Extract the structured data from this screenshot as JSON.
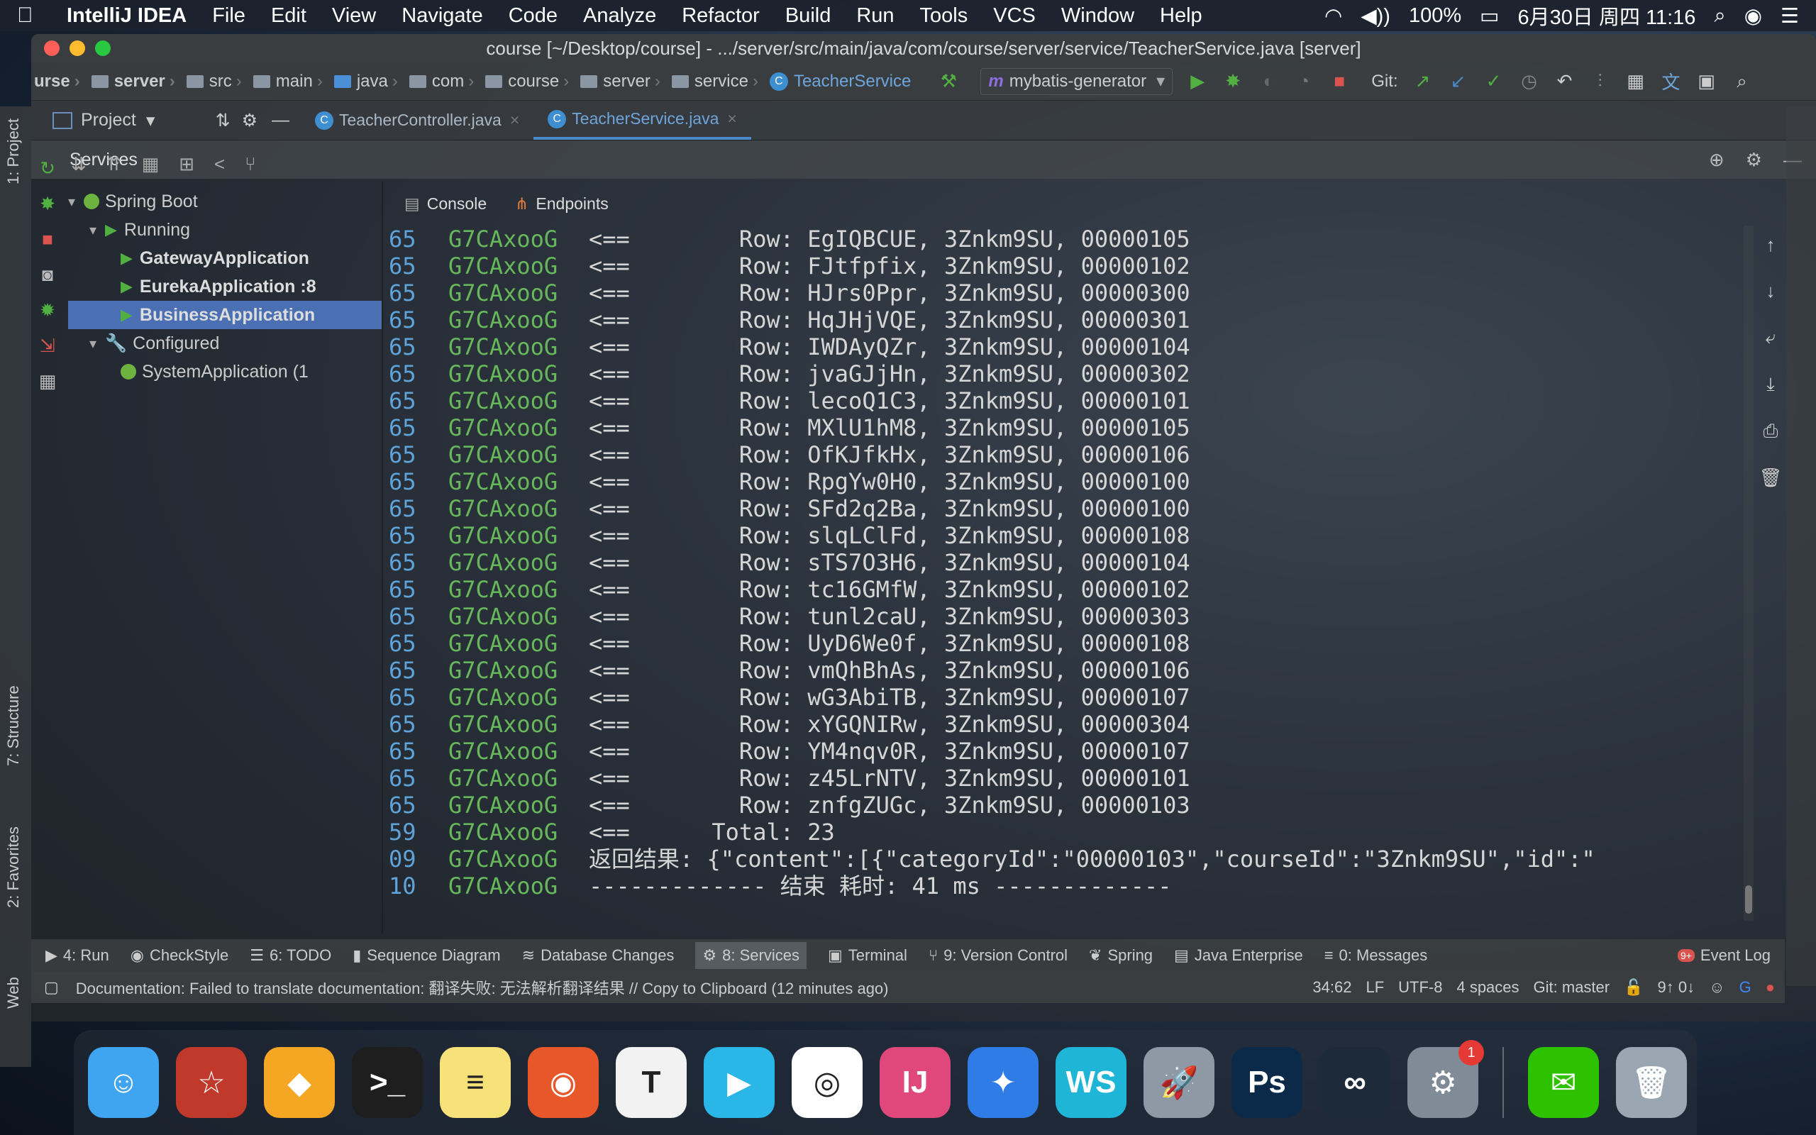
{
  "menubar": {
    "app_name": "IntelliJ IDEA",
    "items": [
      "File",
      "Edit",
      "View",
      "Navigate",
      "Code",
      "Analyze",
      "Refactor",
      "Build",
      "Run",
      "Tools",
      "VCS",
      "Window",
      "Help"
    ],
    "battery": "100%",
    "datetime": "6月30日 周四  11:16"
  },
  "window": {
    "title": "course [~/Desktop/course] - .../server/src/main/java/com/course/server/service/TeacherService.java [server]"
  },
  "breadcrumbs": [
    "urse",
    "server",
    "src",
    "main",
    "java",
    "com",
    "course",
    "server",
    "service",
    "TeacherService"
  ],
  "run_config": "mybatis-generator",
  "git_label": "Git:",
  "project_tab": "Project",
  "editor_tabs": [
    {
      "label": "TeacherController.java",
      "active": false
    },
    {
      "label": "TeacherService.java",
      "active": true
    }
  ],
  "services_title": "Services",
  "left_strip": {
    "project": "1: Project",
    "structure": "7: Structure",
    "favorites": "2: Favorites",
    "web": "Web"
  },
  "tree": {
    "spring_boot": "Spring Boot",
    "running": "Running",
    "gateway": "GatewayApplication",
    "eureka": "EurekaApplication :8",
    "business": "BusinessApplication",
    "configured": "Configured",
    "system": "SystemApplication (1"
  },
  "console_tabs": {
    "console": "Console",
    "endpoints": "Endpoints"
  },
  "console_lines": [
    {
      "n": "65",
      "t": "G7CAxooG",
      "msg": "<==        Row: EgIQBCUE, 3Znkm9SU, 00000105"
    },
    {
      "n": "65",
      "t": "G7CAxooG",
      "msg": "<==        Row: FJtfpfix, 3Znkm9SU, 00000102"
    },
    {
      "n": "65",
      "t": "G7CAxooG",
      "msg": "<==        Row: HJrs0Ppr, 3Znkm9SU, 00000300"
    },
    {
      "n": "65",
      "t": "G7CAxooG",
      "msg": "<==        Row: HqJHjVQE, 3Znkm9SU, 00000301"
    },
    {
      "n": "65",
      "t": "G7CAxooG",
      "msg": "<==        Row: IWDAyQZr, 3Znkm9SU, 00000104"
    },
    {
      "n": "65",
      "t": "G7CAxooG",
      "msg": "<==        Row: jvaGJjHn, 3Znkm9SU, 00000302"
    },
    {
      "n": "65",
      "t": "G7CAxooG",
      "msg": "<==        Row: lecoQ1C3, 3Znkm9SU, 00000101"
    },
    {
      "n": "65",
      "t": "G7CAxooG",
      "msg": "<==        Row: MXlU1hM8, 3Znkm9SU, 00000105"
    },
    {
      "n": "65",
      "t": "G7CAxooG",
      "msg": "<==        Row: OfKJfkHx, 3Znkm9SU, 00000106"
    },
    {
      "n": "65",
      "t": "G7CAxooG",
      "msg": "<==        Row: RpgYw0H0, 3Znkm9SU, 00000100"
    },
    {
      "n": "65",
      "t": "G7CAxooG",
      "msg": "<==        Row: SFd2q2Ba, 3Znkm9SU, 00000100"
    },
    {
      "n": "65",
      "t": "G7CAxooG",
      "msg": "<==        Row: slqLClFd, 3Znkm9SU, 00000108"
    },
    {
      "n": "65",
      "t": "G7CAxooG",
      "msg": "<==        Row: sTS7O3H6, 3Znkm9SU, 00000104"
    },
    {
      "n": "65",
      "t": "G7CAxooG",
      "msg": "<==        Row: tc16GMfW, 3Znkm9SU, 00000102"
    },
    {
      "n": "65",
      "t": "G7CAxooG",
      "msg": "<==        Row: tunl2caU, 3Znkm9SU, 00000303"
    },
    {
      "n": "65",
      "t": "G7CAxooG",
      "msg": "<==        Row: UyD6We0f, 3Znkm9SU, 00000108"
    },
    {
      "n": "65",
      "t": "G7CAxooG",
      "msg": "<==        Row: vmQhBhAs, 3Znkm9SU, 00000106"
    },
    {
      "n": "65",
      "t": "G7CAxooG",
      "msg": "<==        Row: wG3AbiTB, 3Znkm9SU, 00000107"
    },
    {
      "n": "65",
      "t": "G7CAxooG",
      "msg": "<==        Row: xYGQNIRw, 3Znkm9SU, 00000304"
    },
    {
      "n": "65",
      "t": "G7CAxooG",
      "msg": "<==        Row: YM4nqv0R, 3Znkm9SU, 00000107"
    },
    {
      "n": "65",
      "t": "G7CAxooG",
      "msg": "<==        Row: z45LrNTV, 3Znkm9SU, 00000101"
    },
    {
      "n": "65",
      "t": "G7CAxooG",
      "msg": "<==        Row: znfgZUGc, 3Znkm9SU, 00000103"
    },
    {
      "n": "59",
      "t": "G7CAxooG",
      "msg": "<==      Total: 23"
    },
    {
      "n": "09",
      "t": "G7CAxooG",
      "msg": "返回结果: {\"content\":[{\"categoryId\":\"00000103\",\"courseId\":\"3Znkm9SU\",\"id\":\""
    },
    {
      "n": "10",
      "t": "G7CAxooG",
      "msg": "------------- 结束 耗时: 41 ms -------------"
    }
  ],
  "bottom_tools": [
    {
      "label": "4: Run",
      "icon": "play-icon"
    },
    {
      "label": "CheckStyle",
      "icon": "checkstyle-icon"
    },
    {
      "label": "6: TODO",
      "icon": "list-icon"
    },
    {
      "label": "Sequence Diagram",
      "icon": "sequence-icon"
    },
    {
      "label": "Database Changes",
      "icon": "database-icon"
    },
    {
      "label": "8: Services",
      "icon": "services-icon"
    },
    {
      "label": "Terminal",
      "icon": "terminal-icon"
    },
    {
      "label": "9: Version Control",
      "icon": "vcs-icon"
    },
    {
      "label": "Spring",
      "icon": "spring-icon"
    },
    {
      "label": "Java Enterprise",
      "icon": "enterprise-icon"
    },
    {
      "label": "0: Messages",
      "icon": "messages-icon"
    }
  ],
  "event_log": "Event Log",
  "event_badge": "9+",
  "status": {
    "message": "Documentation: Failed to translate documentation: 翻译失败: 无法解析翻译结果 // Copy to Clipboard (12 minutes ago)",
    "position": "34:62",
    "line_sep": "LF",
    "encoding": "UTF-8",
    "indent": "4 spaces",
    "branch": "Git: master",
    "vcs_counts": "9↑ 0↓"
  },
  "dock_apps": [
    {
      "name": "finder-icon",
      "bg": "#3fa5f0",
      "glyph": "☺"
    },
    {
      "name": "star-app-icon",
      "bg": "#c0392b",
      "glyph": "☆"
    },
    {
      "name": "sketch-icon",
      "bg": "#f5a623",
      "glyph": "◆"
    },
    {
      "name": "terminal-app-icon",
      "bg": "#1e1e1e",
      "glyph": ">_"
    },
    {
      "name": "notes-icon",
      "bg": "#f7e27a",
      "glyph": "≡"
    },
    {
      "name": "firefox-icon",
      "bg": "#e8572a",
      "glyph": "◉"
    },
    {
      "name": "typora-icon",
      "bg": "#f2f2f2",
      "glyph": "T"
    },
    {
      "name": "video-player-icon",
      "bg": "#2bb6e8",
      "glyph": "▶"
    },
    {
      "name": "chrome-icon",
      "bg": "#ffffff",
      "glyph": "◎"
    },
    {
      "name": "intellij-icon",
      "bg": "#e0477a",
      "glyph": "IJ"
    },
    {
      "name": "safari-icon",
      "bg": "#2f7ce6",
      "glyph": "✦"
    },
    {
      "name": "webstorm-icon",
      "bg": "#1fb5d6",
      "glyph": "WS"
    },
    {
      "name": "launchpad-icon",
      "bg": "#8d9aa6",
      "glyph": "🚀"
    },
    {
      "name": "photoshop-icon",
      "bg": "#0b2a4a",
      "glyph": "Ps"
    },
    {
      "name": "nuts-app-icon",
      "bg": "#1c2a3a",
      "glyph": "∞"
    },
    {
      "name": "system-preferences-icon",
      "bg": "#7f8b96",
      "glyph": "⚙"
    },
    {
      "name": "wechat-icon",
      "bg": "#2dc100",
      "glyph": "✉"
    },
    {
      "name": "trash-icon",
      "bg": "#9aa6b2",
      "glyph": "🗑"
    }
  ],
  "sys_prefs_badge": "1"
}
